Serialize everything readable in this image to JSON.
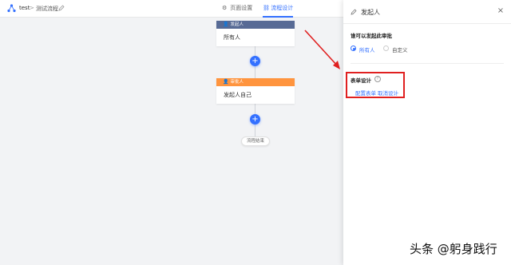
{
  "header": {
    "app_name": "test",
    "separator": ">",
    "flow_name": "测试流程",
    "tabs": [
      {
        "label": "页面设置",
        "icon": "gear-icon",
        "active": false
      },
      {
        "label": "流程设计",
        "icon": "flow-icon",
        "active": true
      }
    ]
  },
  "flow": {
    "nodes": [
      {
        "type": "发起人",
        "content": "所有人",
        "color": "#576a95"
      },
      {
        "type": "审批人",
        "content": "发起人自己",
        "color": "#ff943e"
      }
    ],
    "add_symbol": "+",
    "end_label": "流程结束"
  },
  "drawer": {
    "title": "发起人",
    "close_symbol": "×",
    "approver_section": {
      "label": "谁可以发起此审批",
      "options": [
        {
          "label": "所有人",
          "selected": true
        },
        {
          "label": "自定义",
          "selected": false
        }
      ]
    },
    "form_section": {
      "label": "表单设计",
      "help_symbol": "?",
      "links": [
        "配置表单",
        "取消设计"
      ]
    }
  },
  "colors": {
    "accent": "#3370ff",
    "annotation": "#e02020"
  },
  "watermark": "头条 @躬身践行"
}
